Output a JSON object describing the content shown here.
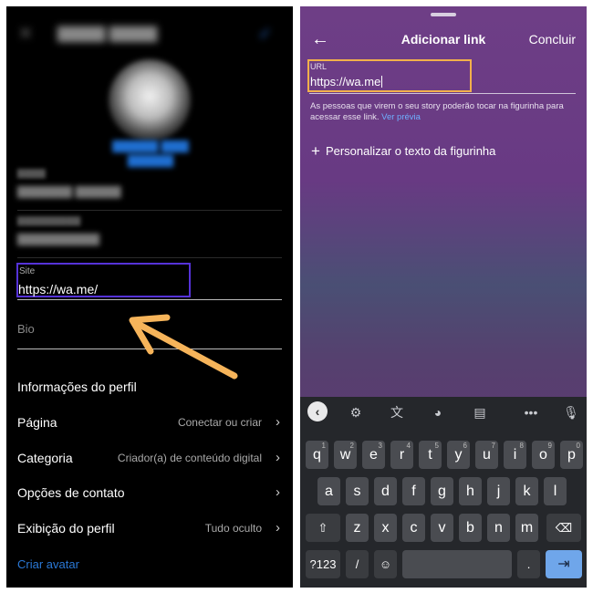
{
  "left": {
    "site": {
      "label": "Site",
      "value": "https://wa.me/"
    },
    "bio": {
      "placeholder": "Bio"
    },
    "menu": [
      {
        "label": "Informações do perfil",
        "value": ""
      },
      {
        "label": "Página",
        "value": "Conectar ou criar"
      },
      {
        "label": "Categoria",
        "value": "Criador(a) de conteúdo digital"
      },
      {
        "label": "Opções de contato",
        "value": ""
      },
      {
        "label": "Exibição do perfil",
        "value": "Tudo oculto"
      }
    ],
    "create_avatar": "Criar avatar"
  },
  "right": {
    "header": {
      "back_icon": "arrow-left-icon",
      "title": "Adicionar link",
      "done": "Concluir"
    },
    "url": {
      "label": "URL",
      "value": "https://wa.me"
    },
    "help_text": "As pessoas que virem o seu story poderão tocar na figurinha para acessar esse link.",
    "help_link": "Ver prévia",
    "customize": "Personalizar o texto da figurinha",
    "keyboard": {
      "toolbar_icons": [
        "back-icon",
        "settings-icon",
        "translate-icon",
        "palette-icon",
        "clipboard-icon",
        "more-icon",
        "mic-icon"
      ],
      "row1": [
        {
          "k": "q",
          "n": "1"
        },
        {
          "k": "w",
          "n": "2"
        },
        {
          "k": "e",
          "n": "3"
        },
        {
          "k": "r",
          "n": "4"
        },
        {
          "k": "t",
          "n": "5"
        },
        {
          "k": "y",
          "n": "6"
        },
        {
          "k": "u",
          "n": "7"
        },
        {
          "k": "i",
          "n": "8"
        },
        {
          "k": "o",
          "n": "9"
        },
        {
          "k": "p",
          "n": "0"
        }
      ],
      "row2": [
        "a",
        "s",
        "d",
        "f",
        "g",
        "h",
        "j",
        "k",
        "l"
      ],
      "row3": [
        "z",
        "x",
        "c",
        "v",
        "b",
        "n",
        "m"
      ],
      "row4": {
        "sym": "?123",
        "slash": "/",
        "period": "."
      }
    }
  },
  "colors": {
    "left_highlight": "#5532d8",
    "right_highlight": "#f2b04b",
    "arrow": "#f6b45a",
    "link": "#2a78d6"
  }
}
